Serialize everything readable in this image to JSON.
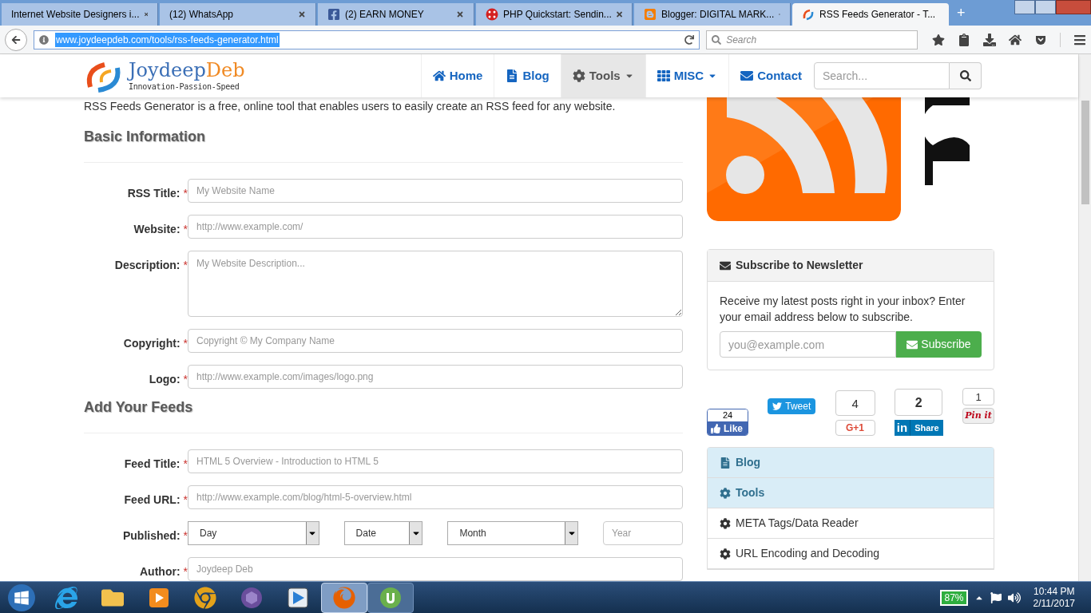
{
  "browser": {
    "tabs": [
      {
        "title": "Internet Website Designers i...",
        "selected": false
      },
      {
        "title": "(12) WhatsApp",
        "selected": false
      },
      {
        "title": "(2) EARN MONEY",
        "selected": false
      },
      {
        "title": "PHP Quickstart: Sendin...",
        "selected": false
      },
      {
        "title": "Blogger: DIGITAL MARK...",
        "selected": false
      },
      {
        "title": "RSS Feeds Generator - T...",
        "selected": true
      }
    ],
    "new_tab": "+",
    "url": "www.joydeepdeb.com/tools/rss-feeds-generator.html",
    "search_placeholder": "Search"
  },
  "site": {
    "logo": {
      "first": "Joydeep",
      "second": "Deb",
      "tagline": "Innovation-Passion-Speed"
    },
    "nav": [
      {
        "label": "Home",
        "dropdown": false,
        "selected": false
      },
      {
        "label": "Blog",
        "dropdown": false,
        "selected": false
      },
      {
        "label": "Tools",
        "dropdown": true,
        "selected": true
      },
      {
        "label": "MISC",
        "dropdown": true,
        "selected": false
      },
      {
        "label": "Contact",
        "dropdown": false,
        "selected": false
      }
    ],
    "search_placeholder": "Search..."
  },
  "intro": "RSS Feeds Generator is a free, online tool that enables users to easily create an RSS feed for any website.",
  "required_mark": "*",
  "sections": [
    {
      "heading": "Basic Information",
      "fields": [
        {
          "label": "RSS Title:",
          "required": true,
          "kind": "input",
          "placeholder": "My Website Name"
        },
        {
          "label": "Website:",
          "required": true,
          "kind": "input",
          "placeholder": "http://www.example.com/"
        },
        {
          "label": "Description:",
          "required": true,
          "kind": "textarea",
          "placeholder": "My Website Description..."
        },
        {
          "label": "Copyright:",
          "required": true,
          "kind": "input",
          "placeholder": "Copyright © My Company Name"
        },
        {
          "label": "Logo:",
          "required": true,
          "kind": "input",
          "placeholder": "http://www.example.com/images/logo.png"
        }
      ]
    },
    {
      "heading": "Add Your Feeds",
      "fields": [
        {
          "label": "Feed Title:",
          "required": true,
          "kind": "input",
          "placeholder": "HTML 5 Overview - Introduction to HTML 5"
        },
        {
          "label": "Feed URL:",
          "required": true,
          "kind": "input",
          "placeholder": "http://www.example.com/blog/html-5-overview.html"
        },
        {
          "label": "Published:",
          "required": true,
          "kind": "date",
          "parts": [
            {
              "kind": "select",
              "value": "Day"
            },
            {
              "kind": "select",
              "value": "Date"
            },
            {
              "kind": "select",
              "value": "Month"
            },
            {
              "kind": "input",
              "placeholder": "Year"
            }
          ]
        },
        {
          "label": "Author:",
          "required": true,
          "kind": "input",
          "placeholder": "Joydeep Deb"
        }
      ]
    }
  ],
  "sidebar": {
    "newsletter": {
      "title": "Subscribe to Newsletter",
      "text": "Receive my latest posts right in your inbox? Enter your email address below to subscribe.",
      "placeholder": "you@example.com",
      "button": "Subscribe"
    },
    "social": [
      {
        "kind": "facebook",
        "count": "24",
        "label": "Like"
      },
      {
        "kind": "twitter",
        "label": "Tweet"
      },
      {
        "kind": "google",
        "count": "4",
        "label": "G+1"
      },
      {
        "kind": "linkedin",
        "count": "2",
        "logo": "in",
        "label": "Share"
      },
      {
        "kind": "pinterest",
        "count": "1",
        "label": "Pin it"
      }
    ],
    "menu": [
      {
        "kind": "header",
        "label": "Blog"
      },
      {
        "kind": "header",
        "label": "Tools"
      },
      {
        "kind": "item",
        "label": "META Tags/Data Reader"
      },
      {
        "kind": "item",
        "label": "URL Encoding and Decoding"
      }
    ]
  },
  "taskbar": {
    "apps": [
      {
        "kind": "ie",
        "selected": false
      },
      {
        "kind": "folder",
        "selected": false
      },
      {
        "kind": "media",
        "selected": false
      },
      {
        "kind": "chrome",
        "selected": false
      },
      {
        "kind": "hexagon",
        "selected": false
      },
      {
        "kind": "player",
        "selected": false
      },
      {
        "kind": "firefox",
        "selected": true
      },
      {
        "kind": "torrent",
        "selected": false
      }
    ],
    "battery": "87%",
    "time": "10:44 PM",
    "date": "2/11/2017"
  }
}
